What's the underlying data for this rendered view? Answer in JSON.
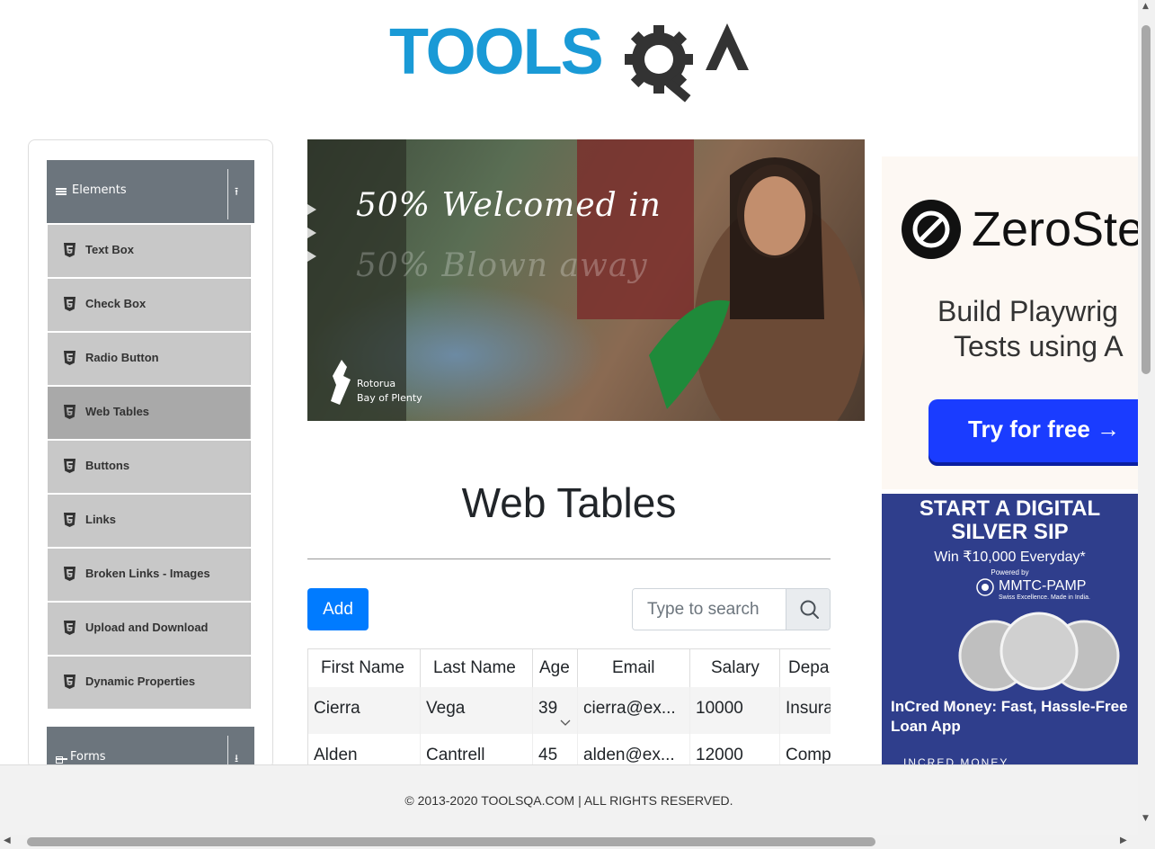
{
  "header": {
    "logo_alt": "TOOLSQA"
  },
  "sidebar": {
    "group_elements": {
      "label": "Elements"
    },
    "items": [
      {
        "label": "Text Box"
      },
      {
        "label": "Check Box"
      },
      {
        "label": "Radio Button"
      },
      {
        "label": "Web Tables",
        "active": true
      },
      {
        "label": "Buttons"
      },
      {
        "label": "Links"
      },
      {
        "label": "Broken Links - Images"
      },
      {
        "label": "Upload and Download"
      },
      {
        "label": "Dynamic Properties"
      }
    ],
    "group_forms": {
      "label": "Forms"
    }
  },
  "banner": {
    "line1": "50% Welcomed in",
    "line2": "50% Blown away",
    "loc1": "Rotorua",
    "loc2": "Bay of Plenty"
  },
  "main": {
    "title": "Web Tables",
    "add_label": "Add",
    "search_placeholder": "Type to search",
    "columns": [
      "First Name",
      "Last Name",
      "Age",
      "Email",
      "Salary",
      "Depa"
    ],
    "rows": [
      [
        "Cierra",
        "Vega",
        "39",
        "cierra@ex...",
        "10000",
        "Insura"
      ],
      [
        "Alden",
        "Cantrell",
        "45",
        "alden@ex...",
        "12000",
        "Comp"
      ]
    ]
  },
  "ads": {
    "ad1": {
      "brand": "ZeroSte",
      "line1": "Build Playwrig",
      "line2": "Tests using A",
      "cta": "Try for free →"
    },
    "ad2": {
      "headline1": "START A DIGITAL",
      "headline2": "SILVER SIP",
      "win": "Win ₹10,000 Everyday*",
      "powered": "Powered by",
      "partner": "MMTC-PAMP",
      "partner_tag": "Swiss Excellence. Made in India.",
      "caption": "InCred Money: Fast, Hassle-Free Loan App",
      "brand_small": "INCRED MONEY"
    }
  },
  "footer": {
    "text": "© 2013-2020 TOOLSQA.COM | ALL RIGHTS RESERVED."
  },
  "colors": {
    "primary": "#007bff",
    "sidebar_header": "#6c757d",
    "menu_item": "#c8c8c8",
    "menu_active": "#a9a9a9",
    "logo_blue": "#1a9ad6",
    "logo_dark": "#333333"
  }
}
